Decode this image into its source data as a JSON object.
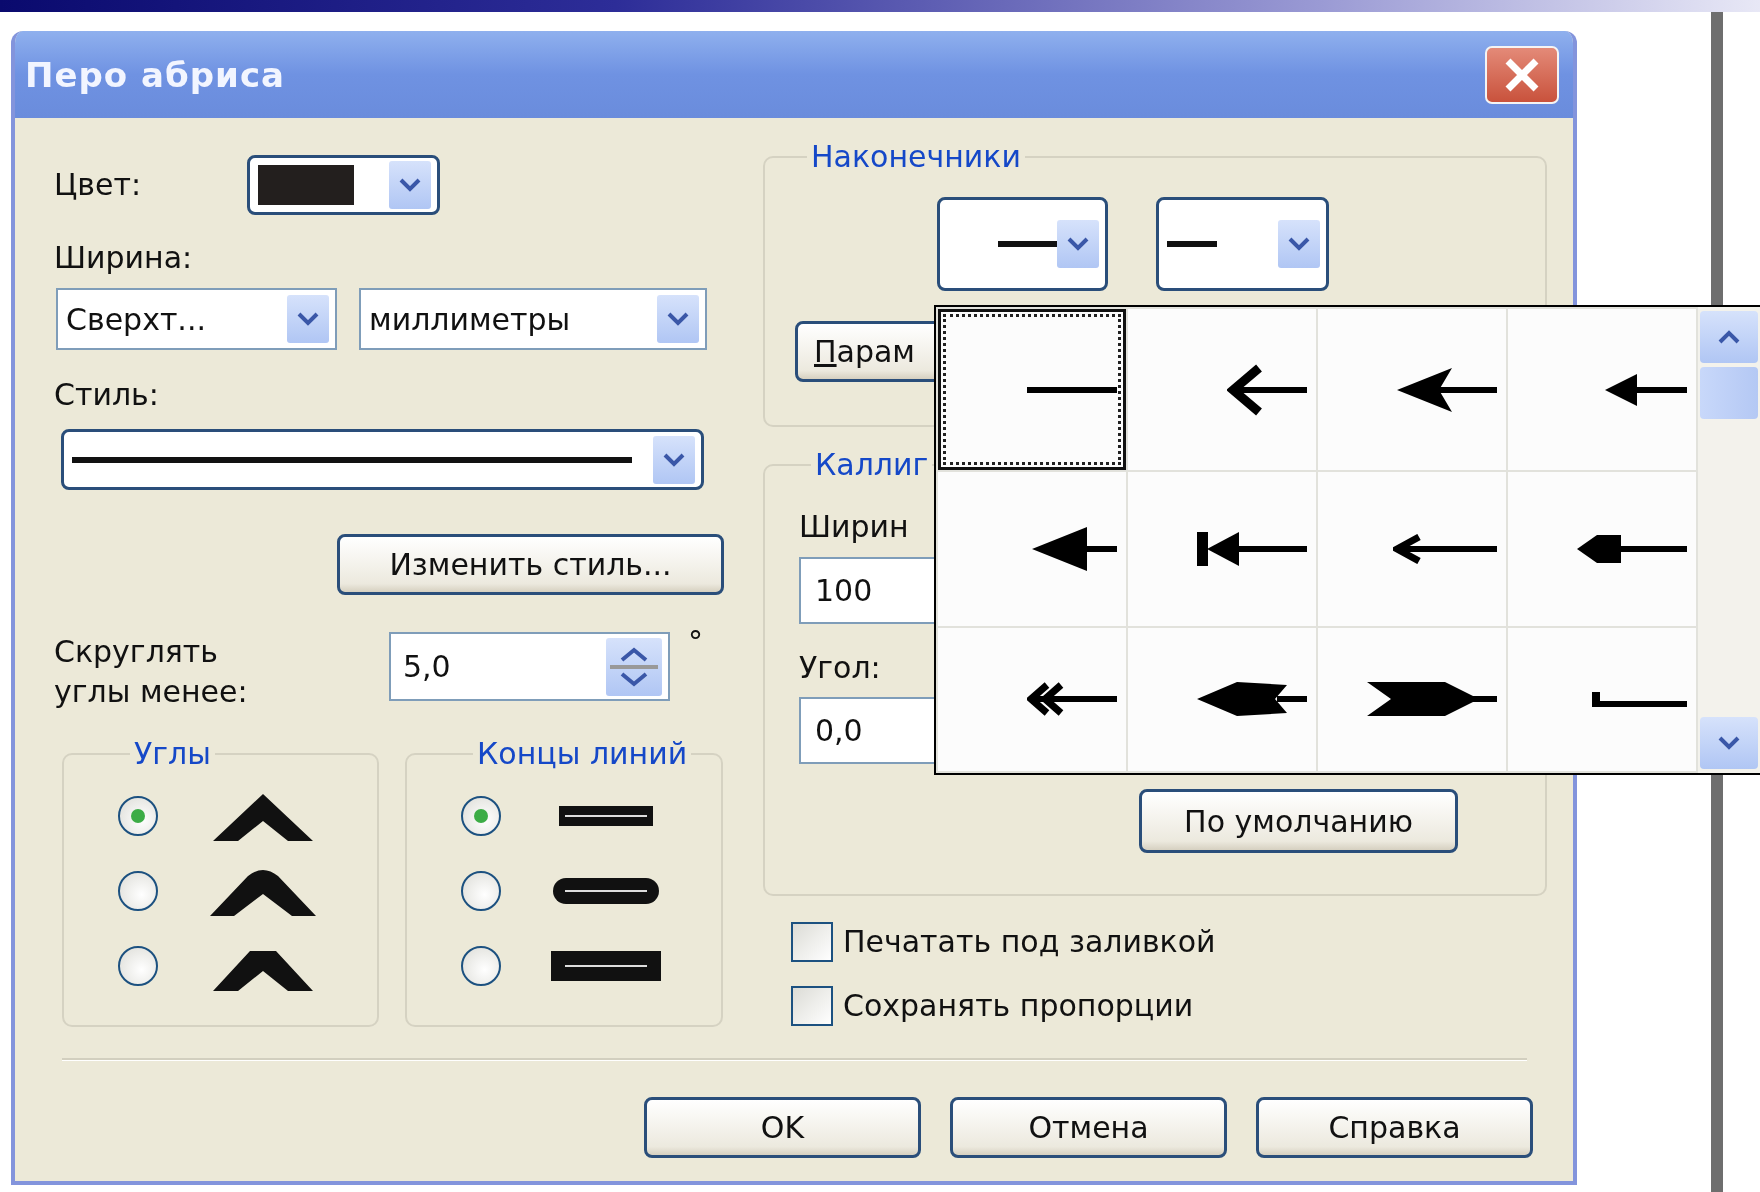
{
  "window": {
    "title": "Перо абриса"
  },
  "color": {
    "label": "Цвет:"
  },
  "width": {
    "label": "Ширина:",
    "value": "Сверхт...",
    "units": "миллиметры"
  },
  "style": {
    "label": "Стиль:",
    "edit_button": "Изменить стиль..."
  },
  "miter": {
    "label": "Скруглять углы менее:",
    "value": "5,0",
    "unit": "°"
  },
  "corners": {
    "title": "Углы",
    "options": [
      {
        "selected": true
      },
      {
        "selected": false
      },
      {
        "selected": false
      }
    ]
  },
  "line_caps": {
    "title": "Концы линий",
    "options": [
      {
        "selected": true
      },
      {
        "selected": false
      },
      {
        "selected": false
      }
    ]
  },
  "arrowheads": {
    "title": "Наконечники",
    "options_button": "Парам"
  },
  "calligraphy": {
    "title": "Каллиг",
    "stretch_label": "Ширин",
    "stretch": "100",
    "angle_label": "Угол:",
    "angle": "0,0",
    "default_button": "По умолчанию"
  },
  "checkboxes": [
    {
      "label": "Печатать под заливкой",
      "checked": false
    },
    {
      "label": "Сохранять пропорции",
      "checked": false
    }
  ],
  "arrowhead_picker": {
    "items": [
      {
        "selected": true
      },
      {
        "selected": false
      },
      {
        "selected": false
      },
      {
        "selected": false
      },
      {
        "selected": false
      },
      {
        "selected": false
      },
      {
        "selected": false
      },
      {
        "selected": false
      },
      {
        "selected": false
      },
      {
        "selected": false
      },
      {
        "selected": false
      },
      {
        "selected": false
      }
    ]
  },
  "buttons": [
    "OK",
    "Отмена",
    "Справка"
  ]
}
